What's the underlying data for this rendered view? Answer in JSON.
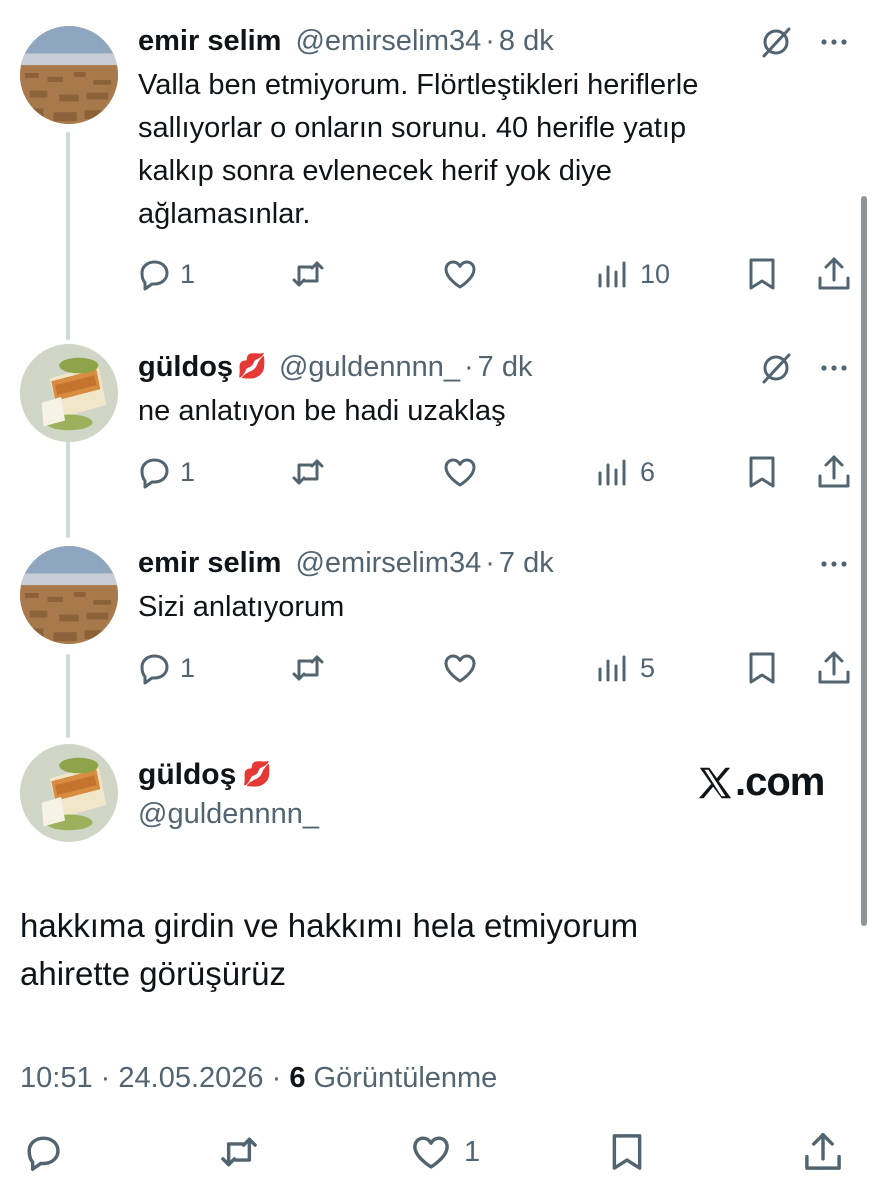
{
  "replies": [
    {
      "name": "emir selim",
      "handle": "@emirselim34",
      "time": "8 dk",
      "text": "Valla ben etmiyorum. Flörtleştikleri heriflerle\nsallıyorlar o onların sorunu.  40 herifle yatıp\nkalkıp sonra evlenecek herif yok diye\nağlamasınlar.",
      "replies": "1",
      "retweets": "",
      "likes": "",
      "views": "10"
    },
    {
      "name": "güldoş",
      "emoji": "💋",
      "handle": "@guldennnn_",
      "time": "7 dk",
      "text": "ne anlatıyon be hadi uzaklaş",
      "replies": "1",
      "retweets": "",
      "likes": "",
      "views": "6"
    },
    {
      "name": "emir selim",
      "handle": "@emirselim34",
      "time": "7 dk",
      "text": "Sizi anlatıyorum",
      "replies": "1",
      "retweets": "",
      "likes": "",
      "views": "5"
    }
  ],
  "main": {
    "name": "güldoş",
    "emoji": "💋",
    "handle": "@guldennnn_",
    "brand": ".com",
    "text": "hakkıma girdin ve hakkımı hela etmiyorum\nahirette görüşürüz",
    "time": "10:51",
    "date": "24.05.2026",
    "views_count": "6",
    "views_label": "Görüntülenme",
    "likes": "1"
  },
  "separator": "·",
  "colors": {
    "text": "#0f1419",
    "secondary": "#536471",
    "thread_line": "#cfd9de"
  },
  "icons": [
    "reply-icon",
    "retweet-icon",
    "like-icon",
    "views-icon",
    "bookmark-icon",
    "share-icon",
    "grok-icon",
    "more-icon",
    "x-logo-icon"
  ]
}
